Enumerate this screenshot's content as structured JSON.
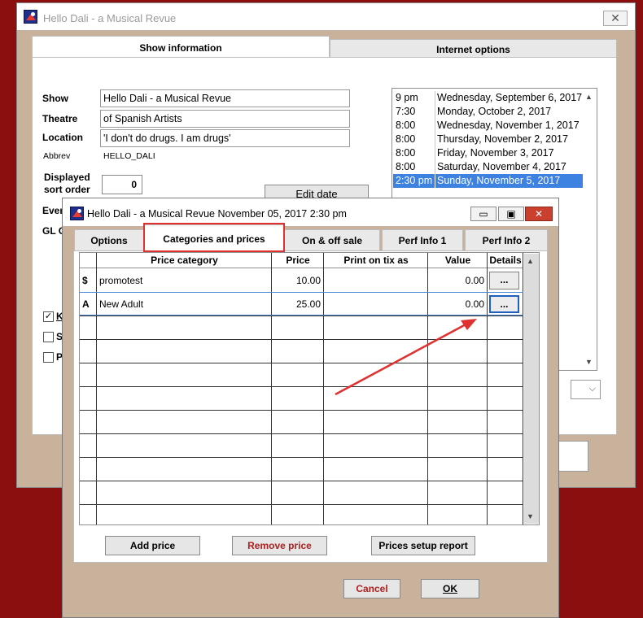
{
  "background_window": {
    "title": "Hello Dali - a Musical Revue",
    "close_glyph": "✕",
    "tabs": [
      {
        "label": "Show information"
      },
      {
        "label": "Internet options"
      }
    ],
    "fields": {
      "show_label": "Show",
      "show_value": "Hello Dali - a Musical Revue",
      "theatre_label": "Theatre",
      "theatre_value": "of Spanish Artists",
      "location_label": "Location",
      "location_value": "'I don't do drugs. I am drugs'",
      "abbrev_label": "Abbrev",
      "abbrev_value": "HELLO_DALI",
      "sort_label_line1": "Displayed",
      "sort_label_line2": "sort order",
      "sort_value": "0",
      "event_label_partial": "Even",
      "gl_label_partial": "GL C"
    },
    "edit_date_label": "Edit date",
    "checkboxes": [
      {
        "label": "K",
        "checked": true
      },
      {
        "label": "S",
        "checked": false
      },
      {
        "label": "P",
        "checked": false
      }
    ],
    "performances": [
      {
        "time": "9 pm",
        "date": "Wednesday, September 6, 2017",
        "selected": false
      },
      {
        "time": "7:30",
        "date": "Monday, October 2, 2017",
        "selected": false
      },
      {
        "time": "8:00",
        "date": "Wednesday, November 1, 2017",
        "selected": false
      },
      {
        "time": "8:00",
        "date": "Thursday, November 2, 2017",
        "selected": false
      },
      {
        "time": "8:00",
        "date": "Friday, November 3, 2017",
        "selected": false
      },
      {
        "time": "8:00",
        "date": "Saturday, November 4, 2017",
        "selected": false
      },
      {
        "time": "2:30 pm",
        "date": "Sunday, November 5, 2017",
        "selected": true
      }
    ]
  },
  "dialog": {
    "title": "Hello Dali - a Musical Revue November 05, 2017 2:30 pm",
    "min_glyph": "▭",
    "max_glyph": "▣",
    "close_glyph": "✕",
    "tabs": [
      {
        "label": "Options",
        "active": false
      },
      {
        "label": "Categories and prices",
        "active": true
      },
      {
        "label": "On & off sale",
        "active": false
      },
      {
        "label": "Perf Info 1",
        "active": false
      },
      {
        "label": "Perf Info 2",
        "active": false
      }
    ],
    "grid": {
      "columns": [
        "Price category",
        "Price",
        "Print on tix as",
        "Value",
        "Details"
      ],
      "rows": [
        {
          "marker": "$",
          "category": "promotest",
          "price": "10.00",
          "print_as": "",
          "value": "0.00",
          "details": "..."
        },
        {
          "marker": "A",
          "category": "New Adult",
          "price": "25.00",
          "print_as": "",
          "value": "0.00",
          "details": "..."
        }
      ]
    },
    "buttons": {
      "add_price": "Add price",
      "remove_price": "Remove price",
      "prices_setup_report": "Prices setup report",
      "cancel": "Cancel",
      "ok": "OK"
    }
  },
  "icons": {
    "scroll_up": "▲",
    "scroll_down": "▼",
    "dropdown_chevron": "⌵",
    "checkmark": "✓"
  },
  "colors": {
    "desktop": "#8b0f0f",
    "window_frame": "#c9b29b",
    "selection": "#3d82e0",
    "annotation_red": "#e03030"
  }
}
